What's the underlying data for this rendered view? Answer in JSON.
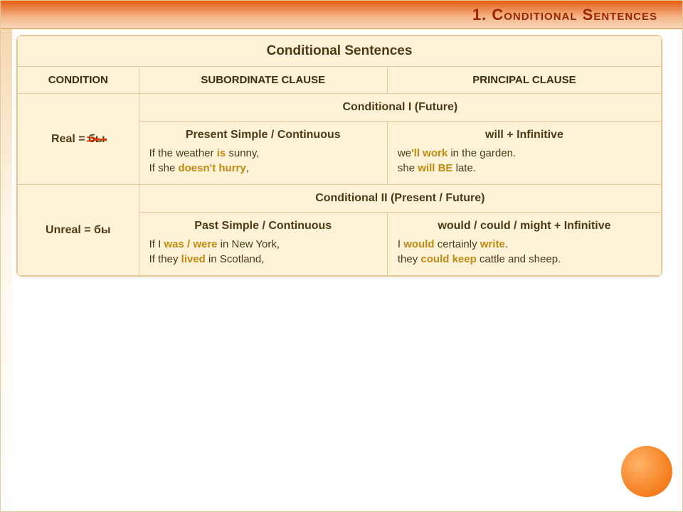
{
  "title": "1.  Conditional  Sentences",
  "table": {
    "mainTitle": "Conditional Sentences",
    "headers": {
      "c1": "CONDITION",
      "c2": "SUBORDINATE CLAUSE",
      "c3": "PRINCIPAL CLAUSE"
    },
    "real": {
      "label_prefix": "Real = ",
      "label_struck": "бы",
      "sectionTitle": "Conditional I (Future)",
      "sub": {
        "leftHeader": "Present Simple / Continuous",
        "rightHeader": "will + Infinitive",
        "l1a": "If the weather ",
        "l1b": "is",
        "l1c": " sunny,",
        "l2a": "If she ",
        "l2b": "doesn't hurry",
        "l2c": ",",
        "r1a": "we",
        "r1b": "'ll work",
        "r1c": " in the garden.",
        "r2a": "she ",
        "r2b": "will BE",
        "r2c": " late."
      }
    },
    "unreal": {
      "label": "Unreal = бы",
      "sectionTitle": "Conditional II (Present / Future)",
      "sub": {
        "leftHeader": "Past Simple / Continuous",
        "rightHeader": "would / could / might + Infinitive",
        "l1a": "If I ",
        "l1b": "was / were",
        "l1c": " in New York,",
        "l2a": "If they ",
        "l2b": "lived",
        "l2c": " in Scotland,",
        "r1a": "I ",
        "r1b": "would",
        "r1c": " certainly ",
        "r1d": "write",
        "r1e": ".",
        "r2a": "they ",
        "r2b": "could keep",
        "r2c": " cattle and sheep."
      }
    }
  }
}
